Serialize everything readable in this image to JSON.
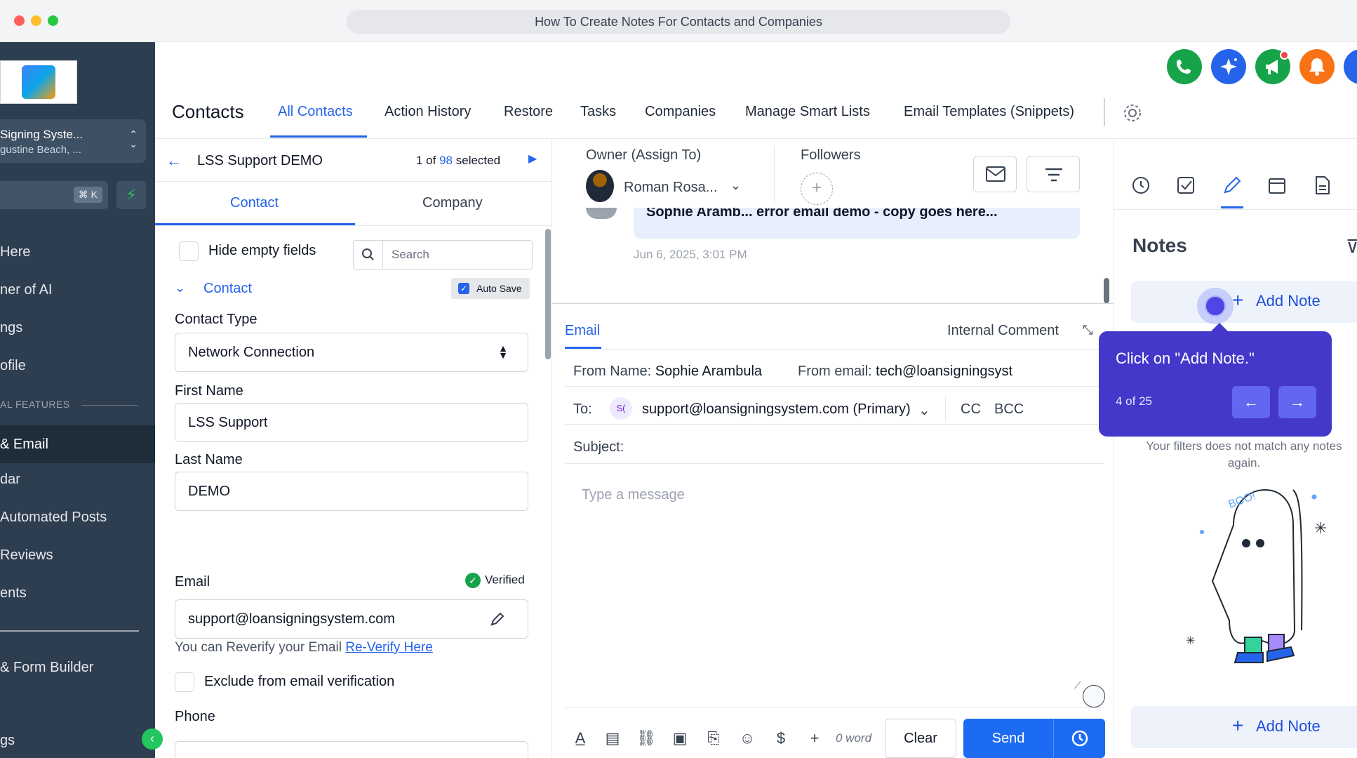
{
  "browser": {
    "title": "How To Create Notes For Contacts and Companies"
  },
  "sidebar": {
    "account_name": "Signing Syste...",
    "account_location": "gustine Beach, ...",
    "shortcut": "⌘ K",
    "items": [
      {
        "label": "Here"
      },
      {
        "label": "ner of AI"
      },
      {
        "label": "ngs"
      },
      {
        "label": "ofile"
      },
      {
        "label": "& Email"
      },
      {
        "label": "dar"
      },
      {
        "label": "Automated Posts"
      },
      {
        "label": "Reviews"
      },
      {
        "label": "ents"
      },
      {
        "label": "& Form Builder"
      },
      {
        "label": "gs"
      }
    ],
    "section_label": "AL FEATURES"
  },
  "header": {
    "page_title": "Contacts",
    "tabs": [
      {
        "label": "All Contacts"
      },
      {
        "label": "Action History"
      },
      {
        "label": "Restore"
      },
      {
        "label": "Tasks"
      },
      {
        "label": "Companies"
      },
      {
        "label": "Manage Smart Lists"
      },
      {
        "label": "Email Templates (Snippets)"
      }
    ],
    "action_icons": [
      "phone-icon",
      "sparkle-icon",
      "megaphone-icon",
      "bell-icon"
    ],
    "colors": {
      "phone": "#16a34a",
      "sparkle": "#2563eb",
      "megaphone": "#16a34a",
      "bell": "#f97316"
    }
  },
  "contact_panel": {
    "title": "LSS Support DEMO",
    "pager_prefix": "1 of",
    "pager_count": "98",
    "pager_suffix": "selected",
    "tabs": [
      {
        "label": "Contact"
      },
      {
        "label": "Company"
      }
    ],
    "hide_empty_label": "Hide empty fields",
    "search_placeholder": "Search",
    "section_title": "Contact",
    "autosave_label": "Auto Save",
    "contact_type_label": "Contact Type",
    "contact_type_value": "Network Connection",
    "first_name_label": "First Name",
    "first_name_value": "LSS Support",
    "last_name_label": "Last Name",
    "last_name_value": "DEMO",
    "email_label": "Email",
    "verified_label": "Verified",
    "email_value": "support@loansigningsystem.com",
    "reverify_text": "You can Reverify your Email",
    "reverify_link": "Re-Verify Here",
    "exclude_label": "Exclude from email verification",
    "phone_label": "Phone"
  },
  "conversation": {
    "owner_label": "Owner (Assign To)",
    "owner_name": "Roman Rosa...",
    "followers_label": "Followers",
    "message_preview": "Sophie Aramb...   error email demo  -  copy goes here...",
    "message_time": "Jun 6, 2025, 3:01 PM",
    "tabs": {
      "email": "Email",
      "internal": "Internal Comment"
    },
    "from_name_label": "From Name:",
    "from_name_value": "Sophie Arambula",
    "from_email_label": "From email:",
    "from_email_value": "tech@loansigningsyst",
    "to_label": "To:",
    "to_initials": "S(",
    "to_value": "support@loansigningsystem.com (Primary)",
    "cc_label": "CC",
    "bcc_label": "BCC",
    "subject_label": "Subject:",
    "message_placeholder": "Type a message",
    "word_count": "0 word",
    "clear_label": "Clear",
    "send_label": "Send"
  },
  "notes_panel": {
    "title": "Notes",
    "add_note_label": "Add Note",
    "empty_message": "Your filters does not match any notes again.",
    "ghost_text": "BOO!"
  },
  "tour": {
    "instruction": "Click on \"Add Note.\"",
    "step": "4 of 25"
  }
}
